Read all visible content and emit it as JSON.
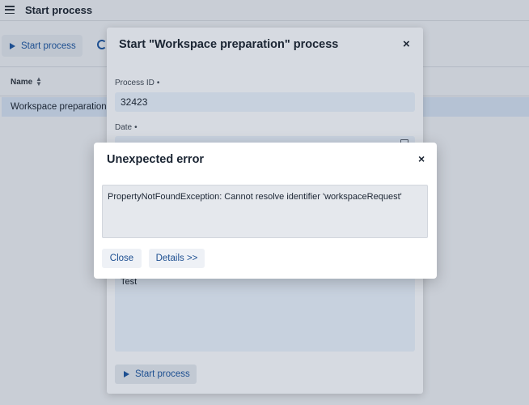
{
  "header": {
    "title": "Start process"
  },
  "toolbar": {
    "start_label": "Start process"
  },
  "table": {
    "columns": [
      "Name"
    ],
    "rows": [
      {
        "name": "Workspace preparation"
      }
    ]
  },
  "start_dialog": {
    "title": "Start \"Workspace preparation\" process",
    "process_id_label": "Process ID",
    "process_id_value": "32423",
    "date_label": "Date",
    "required_marker": "•",
    "comment_value": "Test",
    "start_label": "Start process"
  },
  "error_dialog": {
    "title": "Unexpected error",
    "message": "PropertyNotFoundException: Cannot resolve identifier 'workspaceRequest'",
    "close_label": "Close",
    "details_label": "Details >>"
  },
  "icons": {
    "close": "×",
    "sort": "sort-icon",
    "menu": "hamburger-icon"
  }
}
